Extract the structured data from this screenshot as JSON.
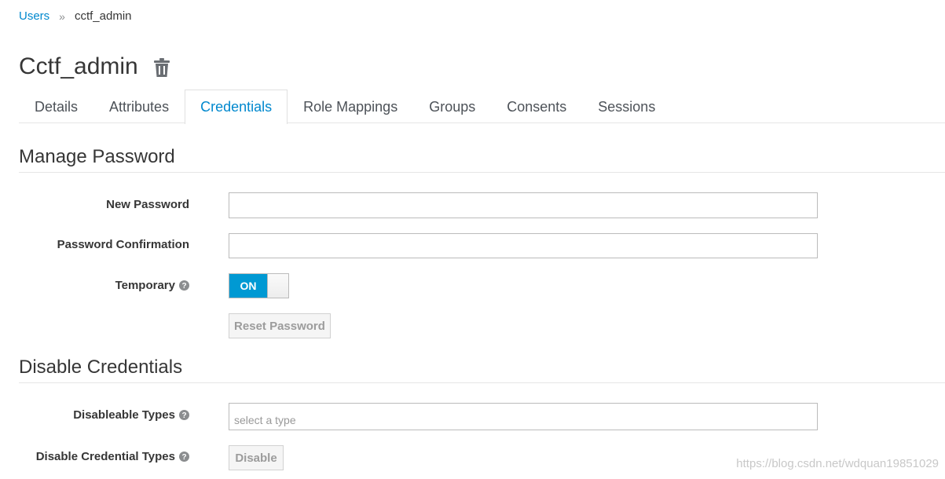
{
  "breadcrumb": {
    "users_label": "Users",
    "separator": "»",
    "current": "cctf_admin"
  },
  "page": {
    "title": "Cctf_admin",
    "delete_icon": "trash-icon"
  },
  "tabs": [
    {
      "label": "Details",
      "active": false
    },
    {
      "label": "Attributes",
      "active": false
    },
    {
      "label": "Credentials",
      "active": true
    },
    {
      "label": "Role Mappings",
      "active": false
    },
    {
      "label": "Groups",
      "active": false
    },
    {
      "label": "Consents",
      "active": false
    },
    {
      "label": "Sessions",
      "active": false
    }
  ],
  "manage_password": {
    "title": "Manage Password",
    "new_password_label": "New Password",
    "new_password_value": "",
    "confirmation_label": "Password Confirmation",
    "confirmation_value": "",
    "temporary_label": "Temporary",
    "temporary_toggle": "ON",
    "reset_button": "Reset Password"
  },
  "disable_credentials": {
    "title": "Disable Credentials",
    "types_label": "Disableable Types",
    "types_placeholder": "select a type",
    "disable_label": "Disable Credential Types",
    "disable_button": "Disable"
  },
  "watermark": "https://blog.csdn.net/wdquan19851029",
  "colors": {
    "accent": "#0088ce",
    "toggle_on": "#0099d3",
    "text": "#363636"
  }
}
